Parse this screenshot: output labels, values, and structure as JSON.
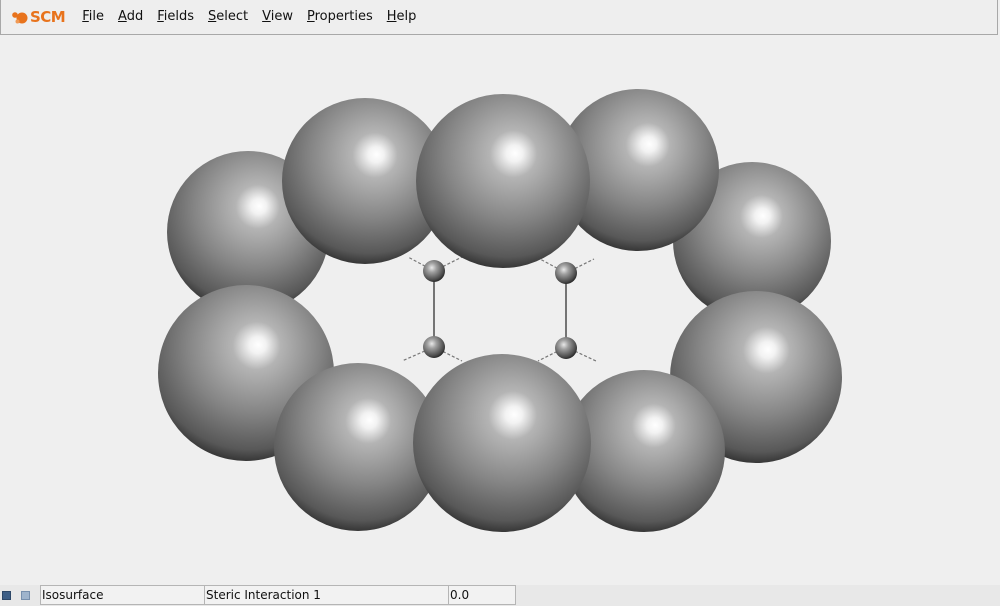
{
  "app": {
    "logo_text": "SCM",
    "brand_color": "#e8731c"
  },
  "menu": [
    {
      "label": "File",
      "mnemonic": "F",
      "rest": "ile"
    },
    {
      "label": "Add",
      "mnemonic": "A",
      "rest": "dd"
    },
    {
      "label": "Fields",
      "mnemonic": "F",
      "rest": "ields"
    },
    {
      "label": "Select",
      "mnemonic": "S",
      "rest": "elect"
    },
    {
      "label": "View",
      "mnemonic": "V",
      "rest": "iew"
    },
    {
      "label": "Properties",
      "mnemonic": "P",
      "rest": "roperties"
    },
    {
      "label": "Help",
      "mnemonic": "H",
      "rest": "elp"
    }
  ],
  "statusbar": {
    "field_type": "Isosurface",
    "field_name": "Steric Interaction 1",
    "field_value": "0.0"
  },
  "scene": {
    "sphere_color": "#8a8a8a",
    "atom_count": 10,
    "small_atom_count": 4
  }
}
